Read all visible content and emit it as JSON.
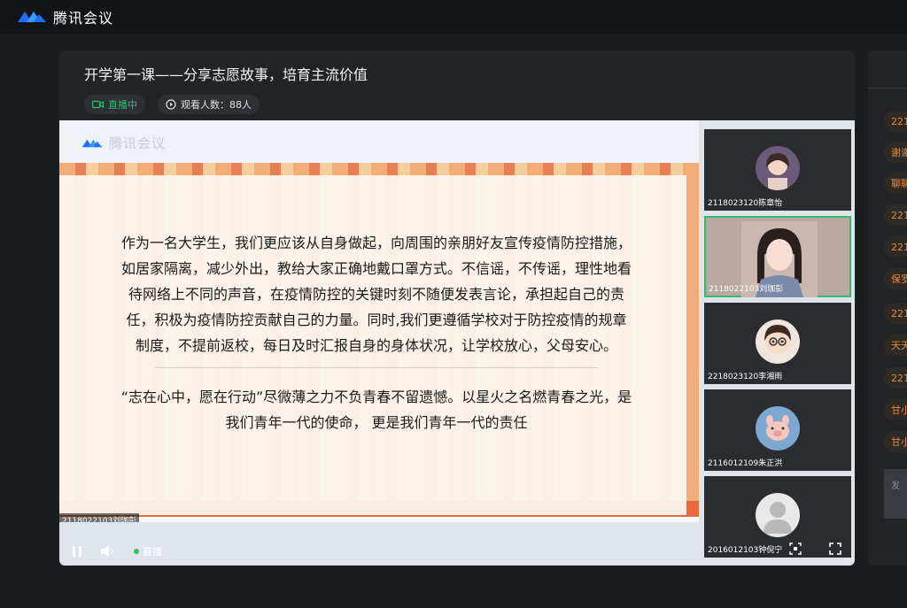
{
  "app": {
    "name": "腾讯会议"
  },
  "meeting": {
    "title": "开学第一课——分享志愿故事，培育主流价值",
    "live_badge": "直播中",
    "viewers_label": "观看人数：88人"
  },
  "slide": {
    "logo_text": "腾讯会议",
    "paragraph1": "作为一名大学生，我们更应该从自身做起，向周围的亲朋好友宣传疫情防控措施，如居家隔离，减少外出，教给大家正确地戴口罩方式。不信谣，不传谣，理性地看待网络上不同的声音，在疫情防控的关键时刻不随便发表言论，承担起自己的责任，积极为疫情防控贡献自己的力量。同时,我们更遵循学校对于防控疫情的规章制度，不提前返校，每日及时汇报自身的身体状况，让学校放心，父母安心。",
    "paragraph2": "“志在心中，愿在行动”尽微薄之力不负青春不留遗憾。以星火之名燃青春之光，是我们青年一代的使命， 更是我们青年一代的责任",
    "stream_label": "2118022103刘珈彭"
  },
  "controls": {
    "live_label": "直播"
  },
  "participants": [
    {
      "name": "2118023120陈章怡",
      "icon": "avatar-girl-icon"
    },
    {
      "name": "2118022103刘珈彭",
      "icon": "video-feed",
      "active": true
    },
    {
      "name": "2218023120李湘雨",
      "icon": "avatar-cartoon-icon"
    },
    {
      "name": "2116012109朱正洪",
      "icon": "avatar-pig-icon"
    },
    {
      "name": "2016012103钟倪宁",
      "icon": "default-avatar-icon"
    }
  ],
  "chat_chips": [
    "221",
    "谢谢",
    "聊聊",
    "221",
    "221",
    "保罗",
    "221",
    "天天",
    "221",
    "甘小",
    "甘小"
  ],
  "chat_input_placeholder": "发",
  "colors": {
    "accent_green": "#2fbf71",
    "chip_orange": "#e8873a",
    "brand_blue": "#1e6fff"
  }
}
